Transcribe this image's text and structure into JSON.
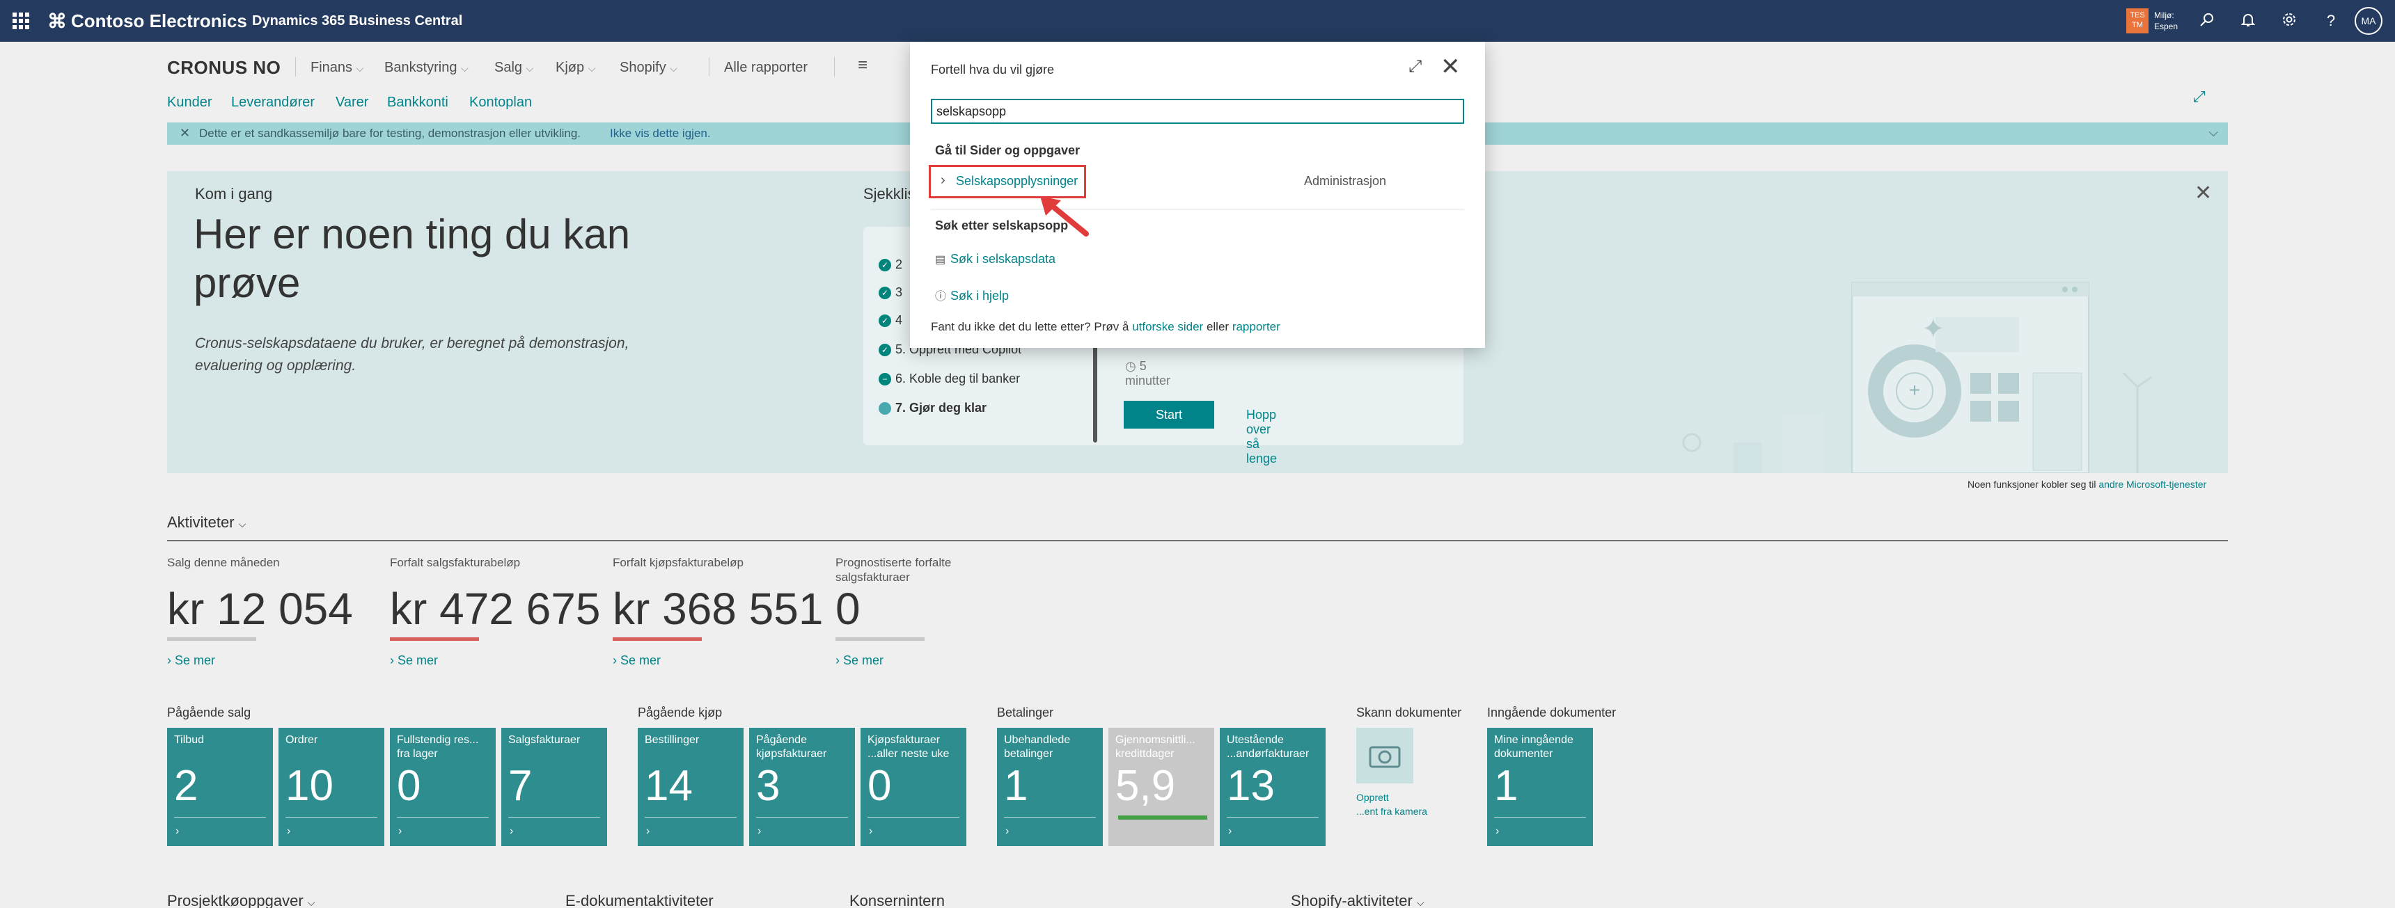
{
  "topbar": {
    "brand": "Contoso Electronics",
    "product": "Dynamics 365 Business Central",
    "env_badge": "TES TM",
    "env_line1": "Miljø:",
    "env_line2": "Espen",
    "avatar": "MA",
    "icons": [
      "waffle-icon",
      "search-icon",
      "bell-icon",
      "gear-icon",
      "help-icon"
    ]
  },
  "header": {
    "company": "CRONUS NO",
    "menu": [
      "Finans",
      "Bankstyring",
      "Salg",
      "Kjøp",
      "Shopify"
    ],
    "all_reports": "Alle rapporter",
    "links": [
      "Kunder",
      "Leverandører",
      "Varer",
      "Bankkonti",
      "Kontoplan"
    ]
  },
  "banner": {
    "message": "Dette er et sandkassemiljø bare for testing, demonstrasjon eller utvikling.",
    "link": "Ikke vis dette igjen."
  },
  "getstarted": {
    "kicker": "Kom i gang",
    "headline": "Her er noen ting du kan prøve",
    "sub": "Cronus-selskapsdataene du bruker, er beregnet på demonstrasjon, evaluering og opplæring.",
    "checklist_title": "Sjekklis",
    "steps": [
      {
        "label": "2",
        "state": "done"
      },
      {
        "label": "3",
        "state": "done"
      },
      {
        "label": "4",
        "state": "done"
      },
      {
        "label": "5. Opprett med Copilot",
        "state": "done"
      },
      {
        "label": "6. Koble deg til banker",
        "state": "skipped"
      },
      {
        "label": "7. Gjør deg klar",
        "state": "current"
      }
    ],
    "time": "5 minutter",
    "start": "Start",
    "skip": "Hopp over så lenge"
  },
  "note": {
    "text": "Noen funksjoner kobler seg til",
    "link": "andre Microsoft-tjenester"
  },
  "activities": {
    "title": "Aktiviteter",
    "kpis": [
      {
        "label": "Salg denne måneden",
        "value": "kr 12 054",
        "bar": "#c8c8c8",
        "more": "Se mer"
      },
      {
        "label": "Forfalt salgsfakturabeløp",
        "value": "kr 472 675",
        "bar": "#d9605a",
        "more": "Se mer"
      },
      {
        "label": "Forfalt kjøpsfakturabeløp",
        "value": "kr 368 551",
        "bar": "#d9605a",
        "more": "Se mer"
      },
      {
        "label": "Prognostiserte forfalte salgsfakturaer",
        "value": "0",
        "bar": "#c8c8c8",
        "more": "Se mer"
      }
    ]
  },
  "groups": {
    "sales": "Pågående salg",
    "purchase": "Pågående kjøp",
    "payments": "Betalinger",
    "scan": "Skann dokumenter",
    "incoming": "Inngående dokumenter"
  },
  "tiles": [
    {
      "label": "Tilbud",
      "value": "2"
    },
    {
      "label": "Ordrer",
      "value": "10"
    },
    {
      "label": "Fullstendig res...\nfra lager",
      "value": "0"
    },
    {
      "label": "Salgsfakturaer",
      "value": "7"
    },
    {
      "label": "Bestillinger",
      "value": "14"
    },
    {
      "label": "Pågående\nkjøpsfakturaer",
      "value": "3"
    },
    {
      "label": "Kjøpsfakturaer\n...aller neste uke",
      "value": "0"
    },
    {
      "label": "Ubehandlede\nbetalinger",
      "value": "1"
    },
    {
      "label": "Gjennomsnittli...\nkredittdager",
      "value": "5,9"
    },
    {
      "label": "Utestående\n...andørfakturaer",
      "value": "13"
    },
    {
      "label": "Mine inngående\ndokumenter",
      "value": "1"
    }
  ],
  "scan_label_1": "Opprett",
  "scan_label_2": "...ent fra kamera",
  "bottom_sections": [
    "Prosjektkøoppgaver",
    "E-dokumentaktiviteter",
    "Konsernintern",
    "Shopify-aktiviteter"
  ],
  "dialog": {
    "title": "Fortell hva du vil gjøre",
    "search_value": "selskapsopp",
    "group_pages": "Gå til Sider og oppgaver",
    "result_name": "Selskapsopplysninger",
    "result_category": "Administrasjon",
    "group_search": "Søk etter selskapsopp",
    "opt_company_data": "Søk i selskapsdata",
    "opt_help": "Søk i hjelp",
    "footer_text": "Fant du ikke det du lette etter? Prøv å",
    "footer_link1": "utforske sider",
    "footer_mid": "eller",
    "footer_link2": "rapporter"
  }
}
